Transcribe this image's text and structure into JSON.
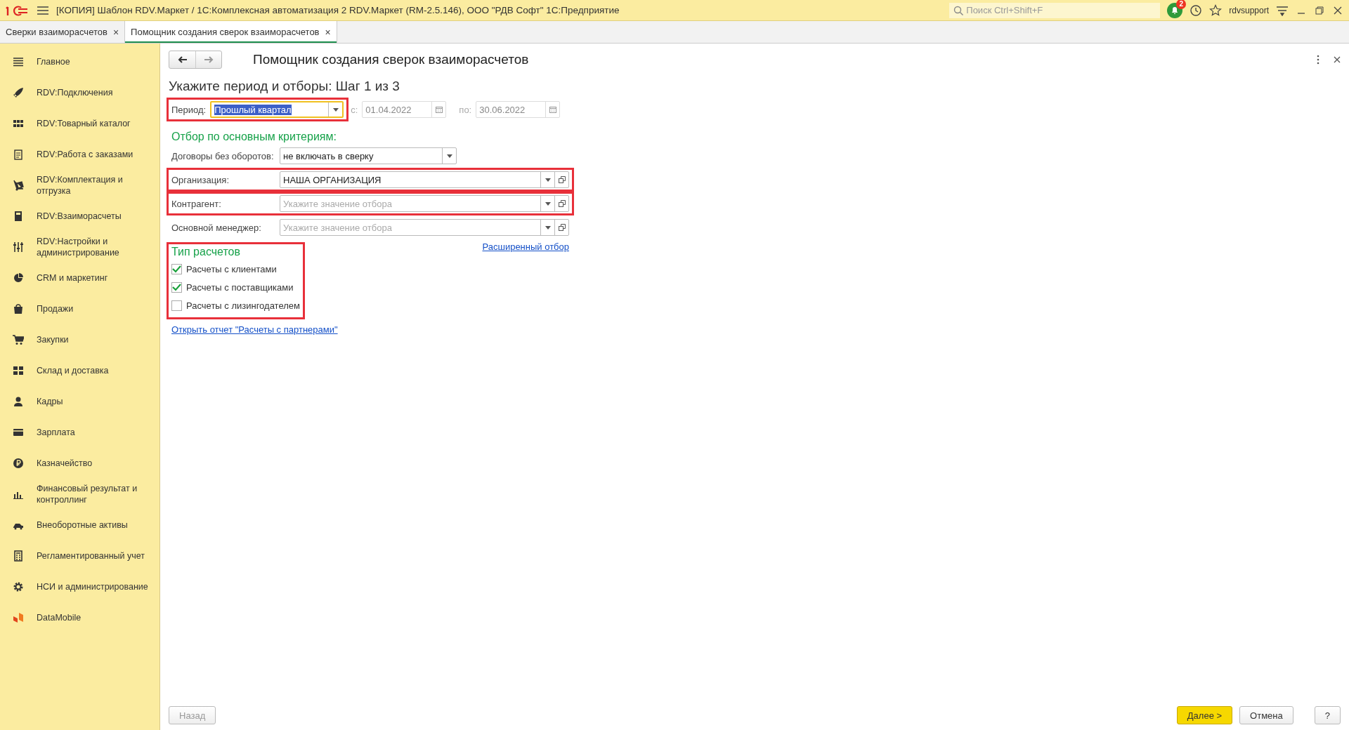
{
  "window": {
    "title": "[КОПИЯ] Шаблон RDV.Маркет / 1С:Комплексная автоматизация 2 RDV.Маркет (RM-2.5.146), ООО \"РДВ Софт\" 1С:Предприятие",
    "search_placeholder": "Поиск Ctrl+Shift+F",
    "notifications": "2",
    "user": "rdvsupport"
  },
  "tabs": [
    {
      "label": "Сверки взаиморасчетов",
      "close": "×",
      "selected": false
    },
    {
      "label": "Помощник создания сверок взаиморасчетов",
      "close": "×",
      "selected": true
    }
  ],
  "sidebar": {
    "items": [
      {
        "label": "Главное"
      },
      {
        "label": "RDV:Подключения"
      },
      {
        "label": "RDV:Товарный каталог"
      },
      {
        "label": "RDV:Работа с заказами"
      },
      {
        "label": "RDV:Комплектация и отгрузка"
      },
      {
        "label": "RDV:Взаиморасчеты"
      },
      {
        "label": "RDV:Настройки и администрирование"
      },
      {
        "label": "CRM и маркетинг"
      },
      {
        "label": "Продажи"
      },
      {
        "label": "Закупки"
      },
      {
        "label": "Склад и доставка"
      },
      {
        "label": "Кадры"
      },
      {
        "label": "Зарплата"
      },
      {
        "label": "Казначейство"
      },
      {
        "label": "Финансовый результат и контроллинг"
      },
      {
        "label": "Внеоборотные активы"
      },
      {
        "label": "Регламентированный учет"
      },
      {
        "label": "НСИ и администрирование"
      },
      {
        "label": "DataMobile"
      }
    ]
  },
  "form": {
    "title": "Помощник создания сверок взаиморасчетов",
    "step_title": "Укажите период и отборы:  Шаг 1 из 3",
    "period": {
      "label": "Период:",
      "value": "Прошлый квартал",
      "highlighted": true,
      "from_label": "с:",
      "from": "01.04.2022",
      "to_label": "по:",
      "to": "30.06.2022"
    },
    "criteria_heading": "Отбор по основным критериям:",
    "contracts": {
      "label": "Договоры без оборотов:",
      "value": "не включать в сверку"
    },
    "filters": [
      {
        "label": "Организация:",
        "value": "НАША ОРГАНИЗАЦИЯ",
        "highlighted": true
      },
      {
        "label": "Контрагент:",
        "placeholder": "Укажите значение отбора",
        "highlighted": true
      },
      {
        "label": "Основной менеджер:",
        "placeholder": "Укажите значение отбора",
        "highlighted": false
      }
    ],
    "advanced_link": "Расширенный отбор",
    "settlement_types": {
      "heading": "Тип расчетов",
      "highlighted": true,
      "items": [
        {
          "label": "Расчеты с клиентами",
          "checked": true
        },
        {
          "label": "Расчеты с поставщиками",
          "checked": true
        },
        {
          "label": "Расчеты с лизингодателем",
          "checked": false
        }
      ]
    },
    "report_link": "Открыть отчет \"Расчеты с партнерами\""
  },
  "buttons": [
    {
      "label": "Назад",
      "kind": "disabled"
    },
    {
      "label": "Далее >",
      "kind": "primary"
    },
    {
      "label": "Отмена",
      "kind": "normal"
    },
    {
      "label": "?",
      "kind": "normal"
    }
  ]
}
